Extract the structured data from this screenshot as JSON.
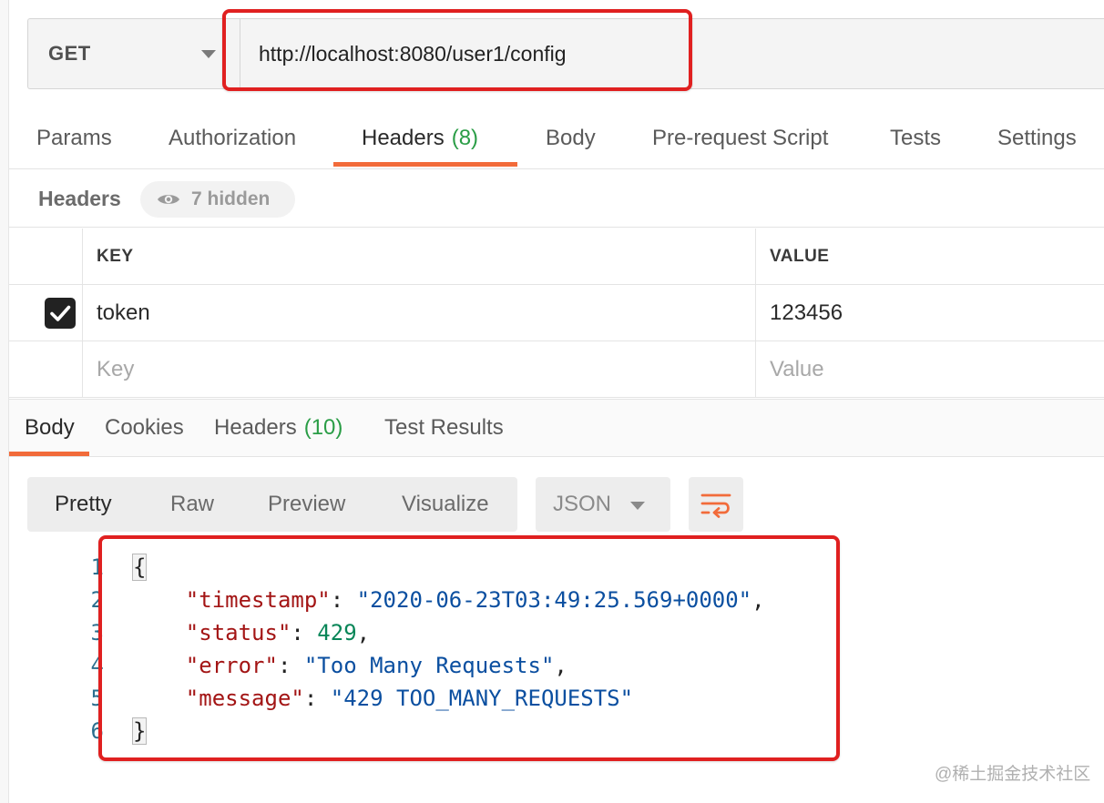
{
  "request": {
    "method": "GET",
    "url": "http://localhost:8080/user1/config"
  },
  "request_tabs": [
    {
      "label": "Params"
    },
    {
      "label": "Authorization"
    },
    {
      "label": "Headers",
      "count": "(8)"
    },
    {
      "label": "Body"
    },
    {
      "label": "Pre-request Script"
    },
    {
      "label": "Tests"
    },
    {
      "label": "Settings"
    }
  ],
  "headers_panel": {
    "title": "Headers",
    "hidden_label": "7 hidden",
    "columns": {
      "key": "KEY",
      "value": "VALUE"
    },
    "rows": [
      {
        "checked": true,
        "key": "token",
        "value": "123456"
      }
    ],
    "new_row": {
      "key_placeholder": "Key",
      "value_placeholder": "Value"
    }
  },
  "response_tabs": [
    {
      "label": "Body"
    },
    {
      "label": "Cookies"
    },
    {
      "label": "Headers",
      "count": "(10)"
    },
    {
      "label": "Test Results"
    }
  ],
  "view_modes": [
    "Pretty",
    "Raw",
    "Preview",
    "Visualize"
  ],
  "format": "JSON",
  "response_body": {
    "line_numbers": [
      "1",
      "2",
      "3",
      "4",
      "5",
      "6"
    ],
    "open_brace": "{",
    "close_brace": "}",
    "fields": [
      {
        "key": "\"timestamp\"",
        "value": "\"2020-06-23T03:49:25.569+0000\"",
        "type": "string",
        "trail": ","
      },
      {
        "key": "\"status\"",
        "value": "429",
        "type": "number",
        "trail": ","
      },
      {
        "key": "\"error\"",
        "value": "\"Too Many Requests\"",
        "type": "string",
        "trail": ","
      },
      {
        "key": "\"message\"",
        "value": "\"429 TOO_MANY_REQUESTS\"",
        "type": "string",
        "trail": ""
      }
    ]
  },
  "colors": {
    "accent": "#f26b3a",
    "highlight": "#e02020",
    "count_green": "#2a9d46",
    "json_key": "#a31515",
    "json_string": "#0b4fa0",
    "json_number": "#098658"
  },
  "watermark": "@稀土掘金技术社区"
}
